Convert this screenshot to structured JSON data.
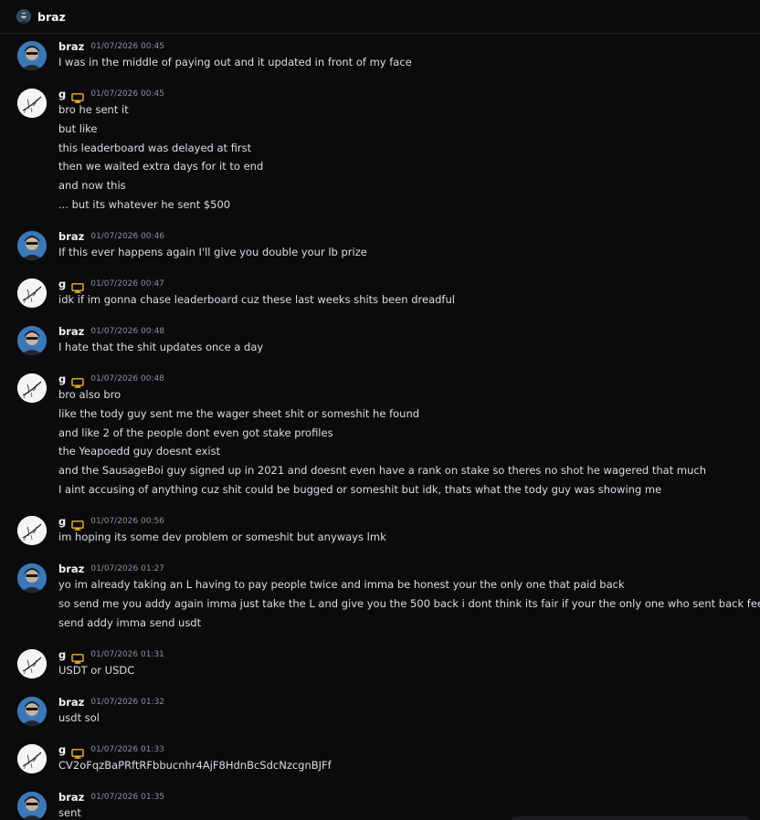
{
  "channel": {
    "name": "braz"
  },
  "messages": [
    {
      "author": "braz",
      "timestamp": "01/07/2026 00:45",
      "lines": [
        "I was in the middle of paying out and it updated in front of my face"
      ]
    },
    {
      "author": "g",
      "timestamp": "01/07/2026 00:45",
      "lines": [
        "bro he sent it",
        "but like",
        "this leaderboard was delayed at first",
        "then we waited extra days for it to end",
        "and now this",
        "... but its whatever he sent $500"
      ]
    },
    {
      "author": "braz",
      "timestamp": "01/07/2026 00:46",
      "lines": [
        "If this ever happens again I'll give you double your lb prize"
      ]
    },
    {
      "author": "g",
      "timestamp": "01/07/2026 00:47",
      "lines": [
        "idk if im gonna chase leaderboard cuz these last weeks shits been dreadful"
      ]
    },
    {
      "author": "braz",
      "timestamp": "01/07/2026 00:48",
      "lines": [
        "I hate that the shit updates once a day"
      ]
    },
    {
      "author": "g",
      "timestamp": "01/07/2026 00:48",
      "lines": [
        "bro also bro",
        "like the tody guy sent me the wager sheet shit or someshit he found",
        "and like 2 of the people dont even got stake profiles",
        "the Yeapoedd guy doesnt exist",
        "and the SausageBoi guy signed up in 2021 and doesnt even have a rank on stake so theres no shot he wagered that much",
        "I aint accusing of anything cuz shit could be bugged or someshit but idk, thats what the tody guy was showing me"
      ]
    },
    {
      "author": "g",
      "timestamp": "01/07/2026 00:56",
      "lines": [
        "im hoping its some dev problem or someshit but anyways lmk"
      ]
    },
    {
      "author": "braz",
      "timestamp": "01/07/2026 01:27",
      "lines": [
        "yo im already taking an L having to pay people twice and imma be honest your the only one that paid back",
        "so send me you addy again imma just take the L and give you the 500 back i dont think its fair if your the only one who sent back feel me",
        "send addy imma send usdt"
      ]
    },
    {
      "author": "g",
      "timestamp": "01/07/2026 01:31",
      "lines": [
        "USDT or USDC"
      ]
    },
    {
      "author": "braz",
      "timestamp": "01/07/2026 01:32",
      "lines": [
        "usdt sol"
      ]
    },
    {
      "author": "g",
      "timestamp": "01/07/2026 01:33",
      "lines": [
        "CV2oFqzBaPRftRFbbucnhr4AjF8HdnBcSdcNzcgnBJFf"
      ]
    },
    {
      "author": "braz",
      "timestamp": "01/07/2026 01:35",
      "lines": [
        "sent"
      ]
    }
  ]
}
